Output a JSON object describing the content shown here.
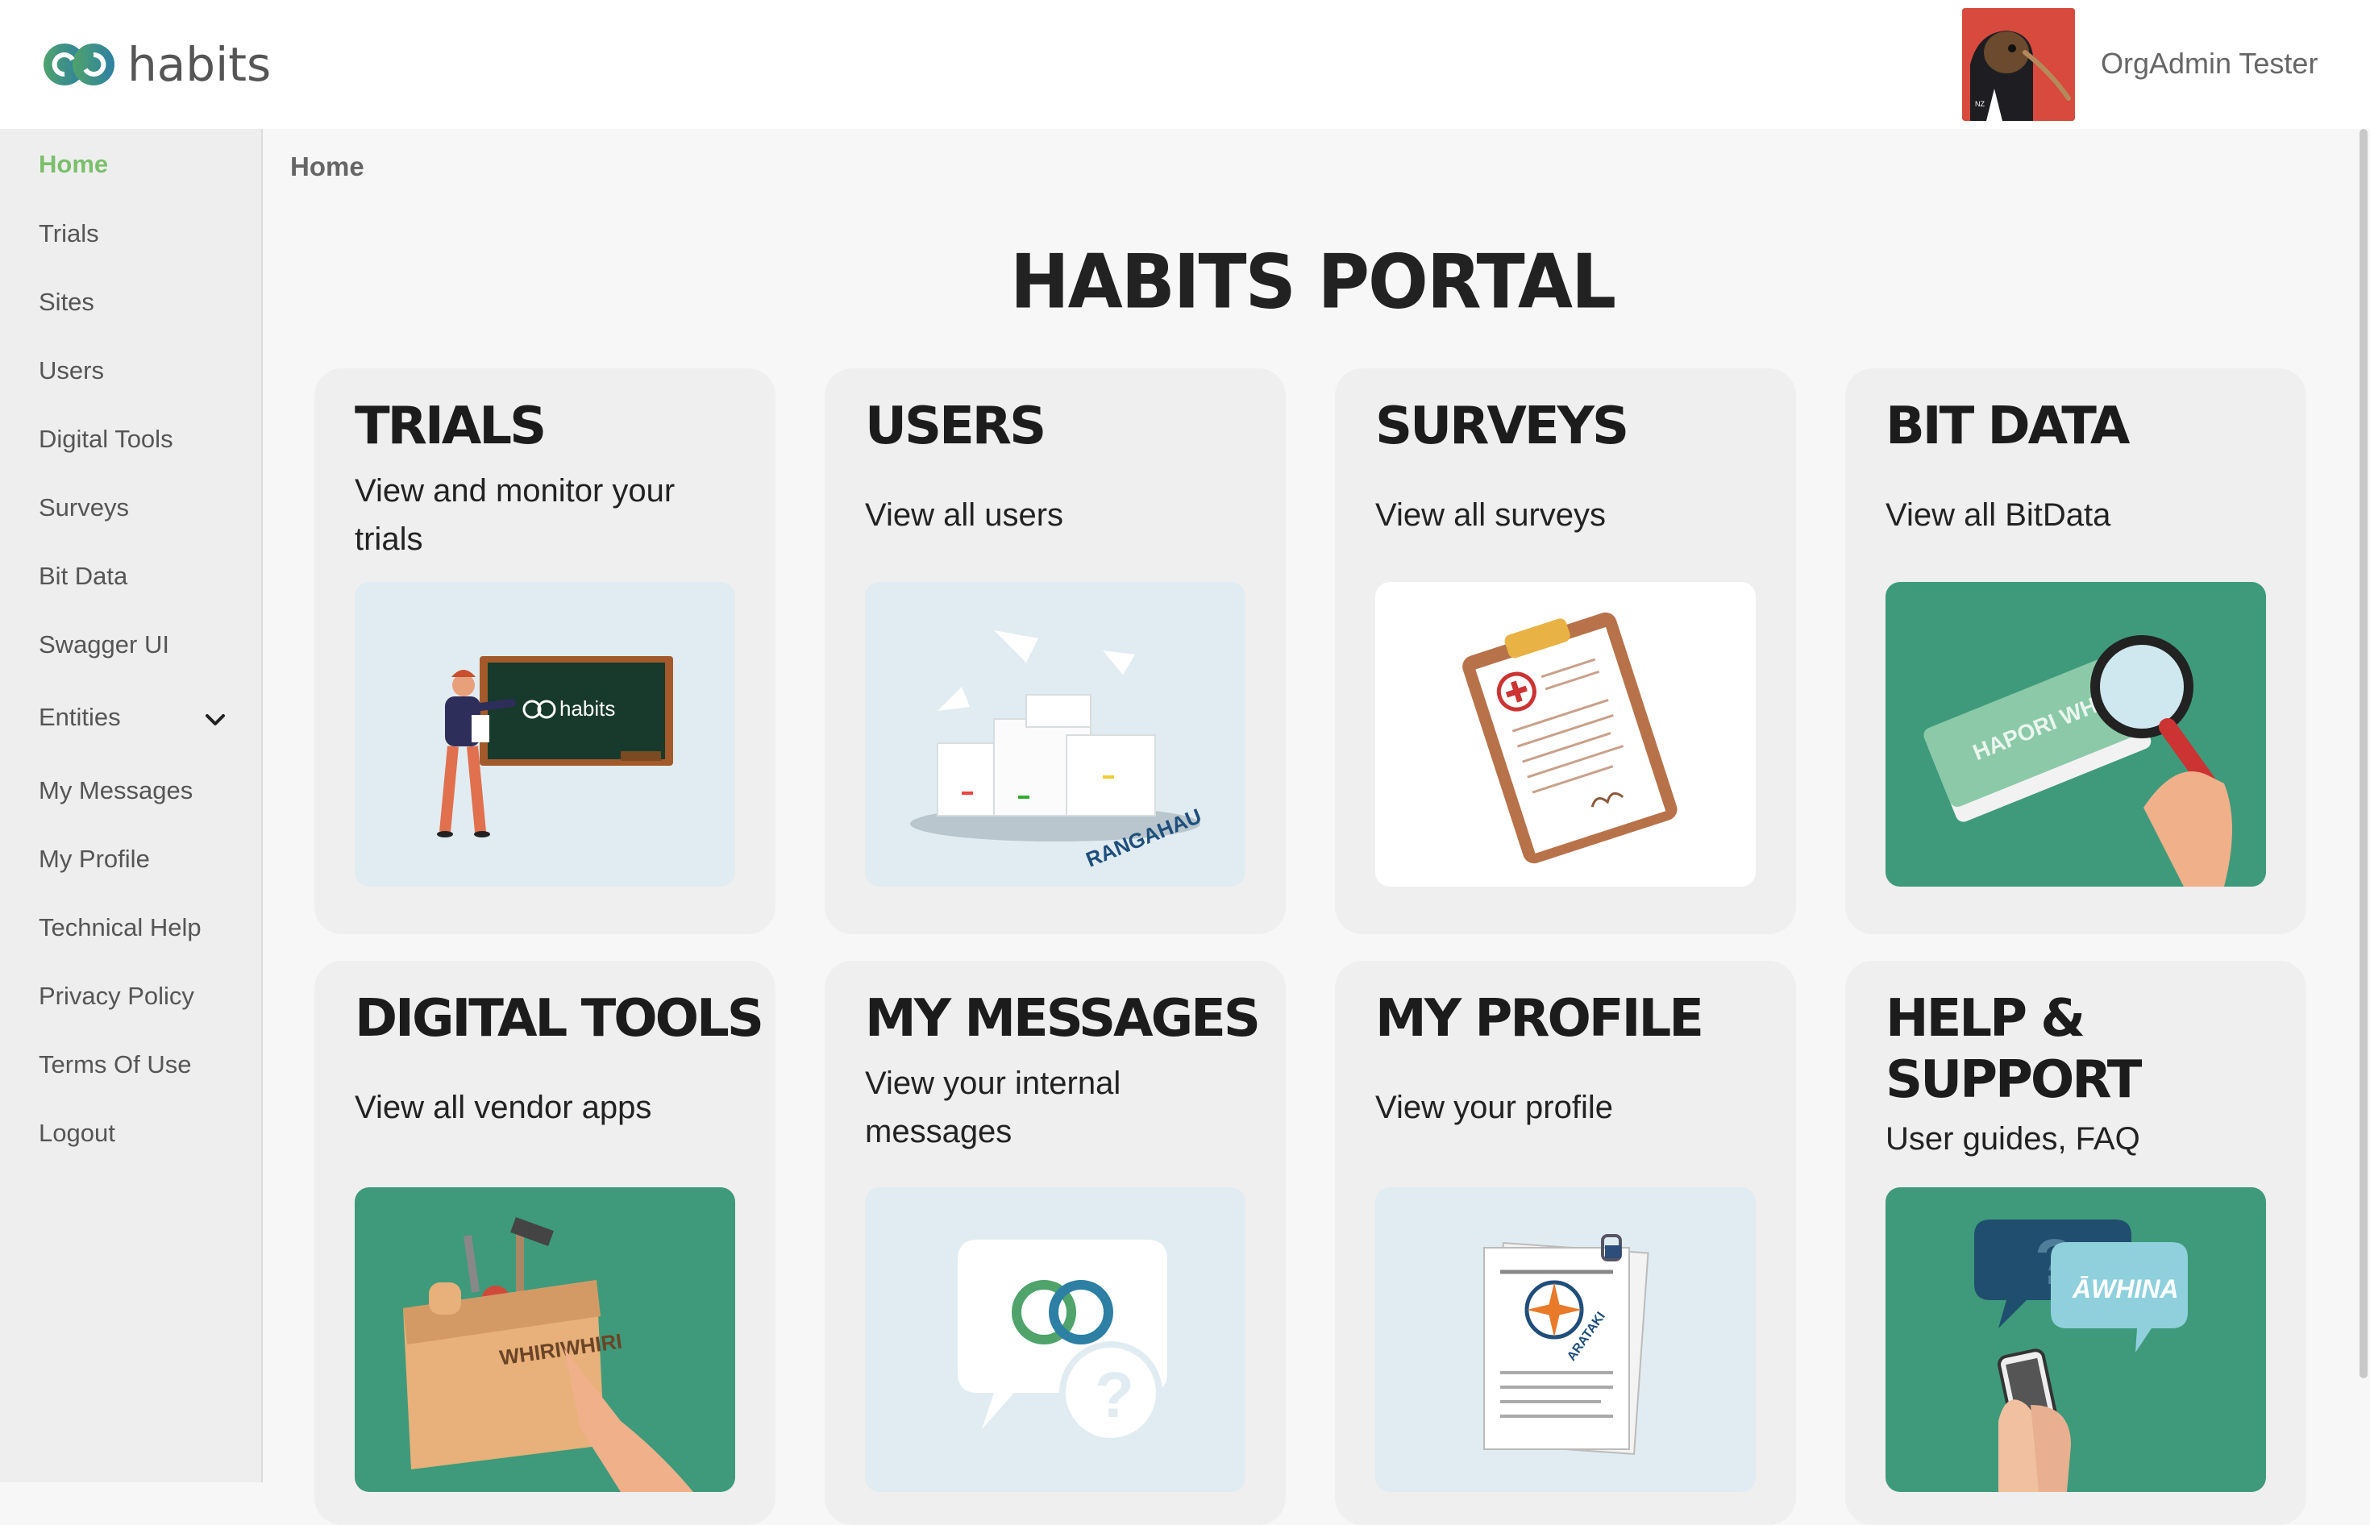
{
  "app": {
    "logo_text": "habits"
  },
  "user": {
    "name": "OrgAdmin Tester"
  },
  "sidebar": {
    "items": [
      {
        "label": "Home"
      },
      {
        "label": "Trials"
      },
      {
        "label": "Sites"
      },
      {
        "label": "Users"
      },
      {
        "label": "Digital Tools"
      },
      {
        "label": "Surveys"
      },
      {
        "label": "Bit Data"
      },
      {
        "label": "Swagger UI"
      },
      {
        "label": "Entities"
      },
      {
        "label": "My Messages"
      },
      {
        "label": "My Profile"
      },
      {
        "label": "Technical Help"
      },
      {
        "label": "Privacy Policy"
      },
      {
        "label": "Terms Of Use"
      },
      {
        "label": "Logout"
      }
    ],
    "active": "Home"
  },
  "breadcrumb": "Home",
  "page_title": "HABITS PORTAL",
  "cards": [
    {
      "title": "TRIALS",
      "desc": "View and monitor your trials",
      "icon": "teacher-chalkboard-illustration"
    },
    {
      "title": "USERS",
      "desc": "View all users",
      "icon": "paper-stacks-illustration",
      "image_text": "RANGAHAU"
    },
    {
      "title": "SURVEYS",
      "desc": "View all surveys",
      "icon": "clipboard-illustration"
    },
    {
      "title": "BIT DATA",
      "desc": "View all BitData",
      "icon": "book-magnifier-illustration",
      "image_text": "HAPORI WHĀNUI"
    },
    {
      "title": "DIGITAL TOOLS",
      "desc": "View all vendor apps",
      "icon": "toolbox-illustration",
      "image_text": "WHIRIWHIRI"
    },
    {
      "title": "MY MESSAGES",
      "desc": "View your internal messages",
      "icon": "speech-bubble-illustration"
    },
    {
      "title": "MY PROFILE",
      "desc": "View your profile",
      "icon": "profile-document-illustration",
      "image_text": "ARATAKI"
    },
    {
      "title": "HELP & SUPPORT",
      "desc": "User guides, FAQ",
      "icon": "help-phone-illustration",
      "image_text": "ĀWHINA"
    }
  ],
  "colors": {
    "active_nav": "#7bbf6a",
    "sidebar_bg": "#eeeeef",
    "card_bg": "#efefef",
    "teal": "#3e9a7a",
    "light_blue": "#e1ecf2"
  }
}
